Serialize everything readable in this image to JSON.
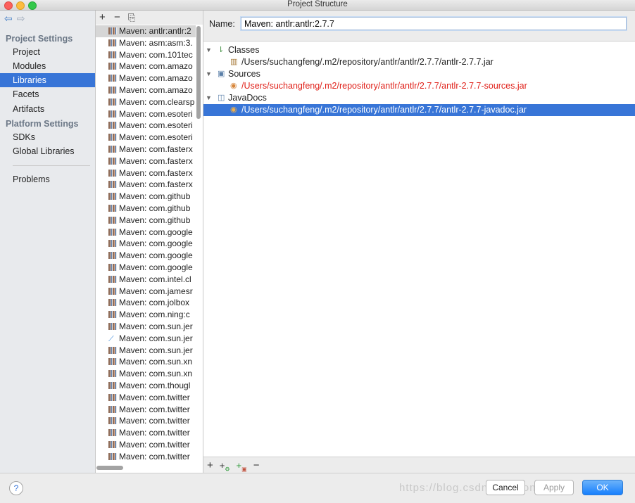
{
  "window": {
    "title": "Project Structure"
  },
  "nav": {
    "sections": [
      {
        "title": "Project Settings",
        "items": [
          "Project",
          "Modules",
          "Libraries",
          "Facets",
          "Artifacts"
        ]
      },
      {
        "title": "Platform Settings",
        "items": [
          "SDKs",
          "Global Libraries"
        ]
      }
    ],
    "problems": "Problems",
    "selected": "Libraries"
  },
  "libraries": {
    "items": [
      "Maven: antlr:antlr:2",
      "Maven: asm:asm:3.",
      "Maven: com.101tec",
      "Maven: com.amazo",
      "Maven: com.amazo",
      "Maven: com.amazo",
      "Maven: com.clearsp",
      "Maven: com.esoteri",
      "Maven: com.esoteri",
      "Maven: com.esoteri",
      "Maven: com.fasterx",
      "Maven: com.fasterx",
      "Maven: com.fasterx",
      "Maven: com.fasterx",
      "Maven: com.github",
      "Maven: com.github",
      "Maven: com.github",
      "Maven: com.google",
      "Maven: com.google",
      "Maven: com.google",
      "Maven: com.google",
      "Maven: com.intel.cl",
      "Maven: com.jamesr",
      "Maven: com.jolbox",
      "Maven: com.ning:c",
      "Maven: com.sun.jer",
      "Maven: com.sun.jer",
      "Maven: com.sun.jer",
      "Maven: com.sun.xn",
      "Maven: com.sun.xn",
      "Maven: com.thougl",
      "Maven: com.twitter",
      "Maven: com.twitter",
      "Maven: com.twitter",
      "Maven: com.twitter",
      "Maven: com.twitter",
      "Maven: com.twitter"
    ]
  },
  "detail": {
    "name_label": "Name:",
    "name_value": "Maven: antlr:antlr:2.7.7",
    "classes_label": "Classes",
    "classes_path": "/Users/suchangfeng/.m2/repository/antlr/antlr/2.7.7/antlr-2.7.7.jar",
    "sources_label": "Sources",
    "sources_path": "/Users/suchangfeng/.m2/repository/antlr/antlr/2.7.7/antlr-2.7.7-sources.jar",
    "javadocs_label": "JavaDocs",
    "javadocs_path": "/Users/suchangfeng/.m2/repository/antlr/antlr/2.7.7/antlr-2.7.7-javadoc.jar"
  },
  "footer": {
    "help": "?",
    "cancel": "Cancel",
    "apply": "Apply",
    "ok": "OK",
    "watermark": "https://blog.csdn.net/...ongdeshi"
  },
  "colors": {
    "selection": "#3875d7",
    "missing_path": "#e0211a",
    "ok_button": "#177ffd"
  }
}
